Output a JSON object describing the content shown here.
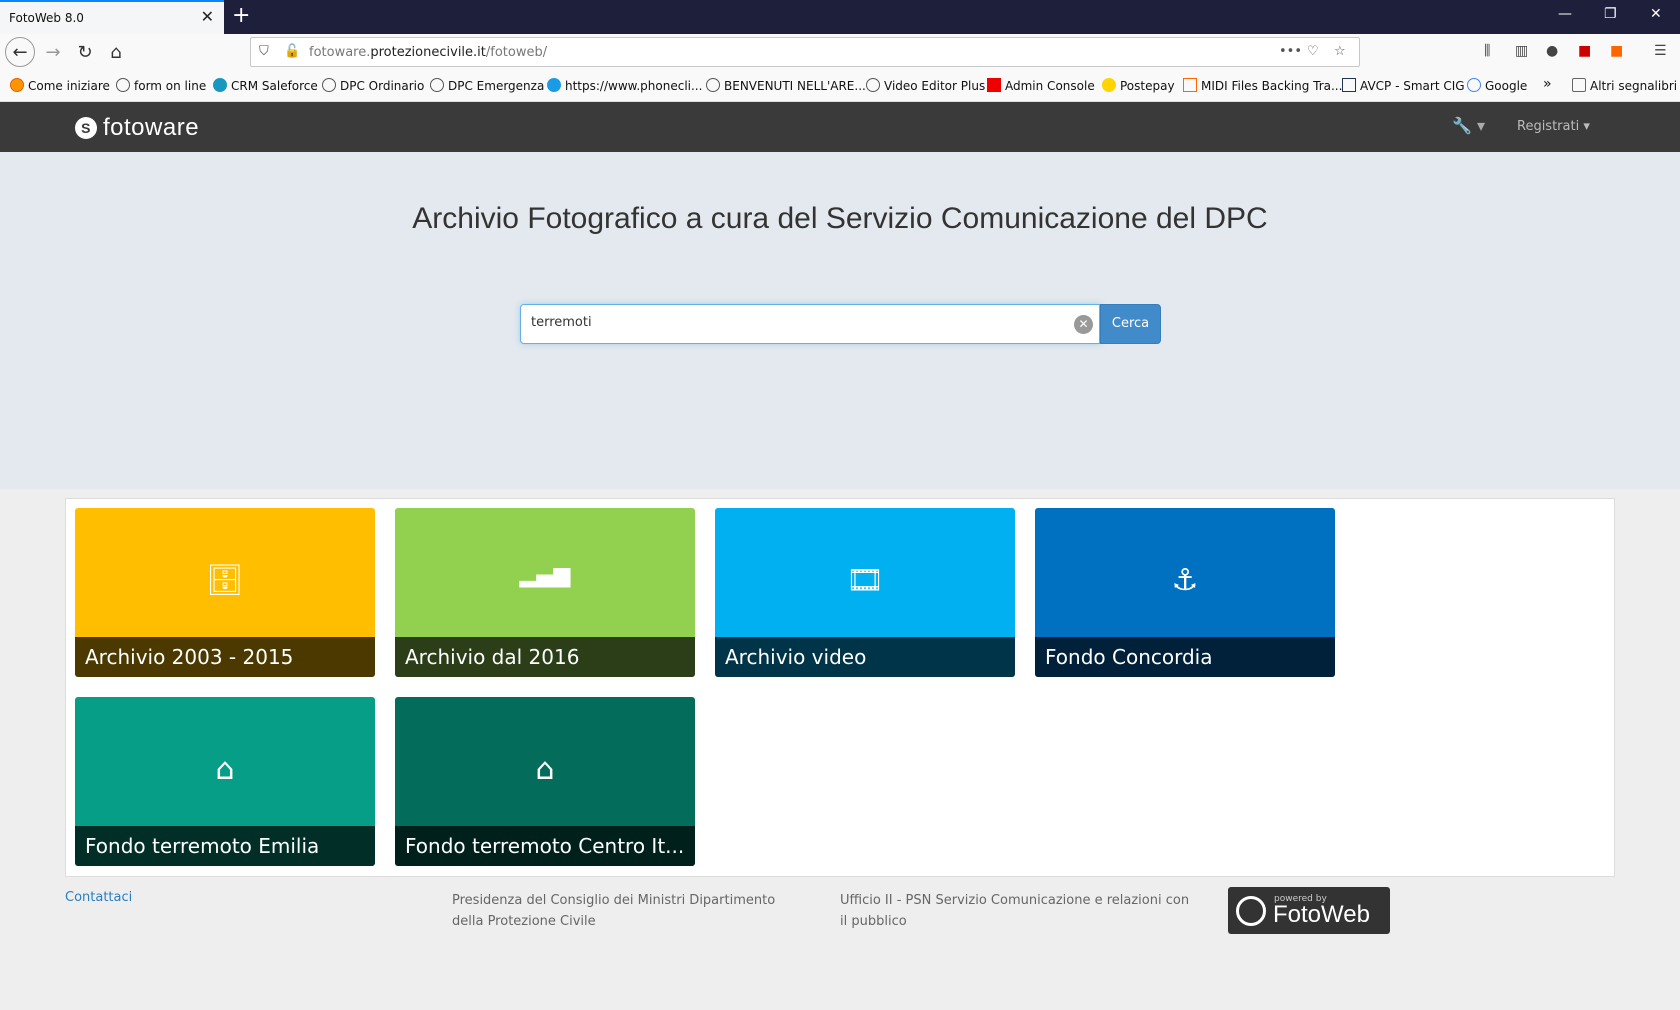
{
  "browser": {
    "tab_title": "FotoWeb 8.0",
    "tab_close": "✕",
    "new_tab": "+",
    "url_domain": "fotoware.",
    "url_host": "protezionecivile.it",
    "url_path": "/fotoweb/",
    "bookmarks": [
      "Come iniziare",
      "form on line",
      "CRM Saleforce",
      "DPC Ordinario",
      "DPC Emergenza",
      "https://www.phonecli...",
      "BENVENUTI NELL'ARE...",
      "Video Editor Plus",
      "Admin Console",
      "Postepay",
      "MIDI Files Backing Tra...",
      "AVCP - Smart CIG",
      "Google",
      "Altri segnalibri"
    ]
  },
  "app": {
    "logo": "fotoware",
    "register_label": "Registrati",
    "hero_title": "Archivio Fotografico a cura del Servizio Comunicazione del DPC",
    "search_value": "terremoti",
    "search_button": "Cerca",
    "tiles": [
      {
        "label": "Archivio 2003 - 2015",
        "color": "#ffbf00",
        "icon": "database-icon",
        "glyph": "🗄"
      },
      {
        "label": "Archivio dal 2016",
        "color": "#92d050",
        "icon": "signal-bars-icon",
        "glyph": "▂▄▆"
      },
      {
        "label": "Archivio video",
        "color": "#00b0f0",
        "icon": "film-icon",
        "glyph": "🎞"
      },
      {
        "label": "Fondo Concordia",
        "color": "#0070c0",
        "icon": "anchor-icon",
        "glyph": "⚓"
      },
      {
        "label": "Fondo terremoto Emilia",
        "color": "#069e87",
        "icon": "home-icon",
        "glyph": "⌂"
      },
      {
        "label": "Fondo terremoto Centro It...",
        "color": "#036c5a",
        "icon": "home-icon",
        "glyph": "⌂"
      }
    ]
  },
  "footer": {
    "contact": "Contattaci",
    "col1": "Presidenza del Consiglio dei Ministri Dipartimento della Protezione Civile",
    "col2": "Ufficio II - PSN Servizio Comunicazione e relazioni con il pubblico",
    "powered_small": "powered by",
    "powered_big": "FotoWeb"
  }
}
